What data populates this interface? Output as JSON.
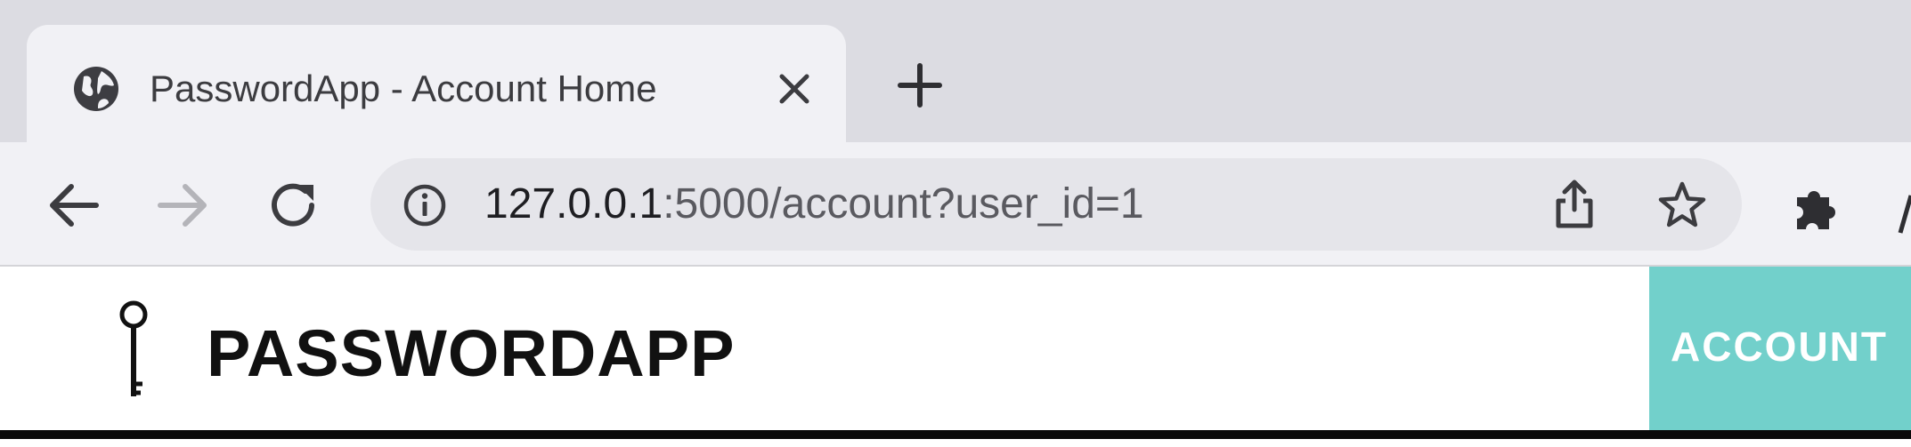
{
  "browser": {
    "tab": {
      "title": "PasswordApp - Account Home",
      "icon": "globe-icon",
      "close_icon": "close-icon"
    },
    "new_tab_icon": "plus-icon",
    "nav": {
      "back_icon": "arrow-left-icon",
      "forward_icon": "arrow-right-icon",
      "reload_icon": "reload-icon"
    },
    "address_bar": {
      "security_icon": "info-icon",
      "url_host": "127.0.0.1",
      "url_rest": ":5000/account?user_id=1",
      "share_icon": "share-icon",
      "bookmark_icon": "star-icon"
    },
    "extensions_icon": "puzzle-icon"
  },
  "app": {
    "logo_icon": "key-icon",
    "brand": "PASSWORDAPP",
    "nav": {
      "account_label": "ACCOUNT",
      "account_color": "#72d0cb"
    },
    "rule_color": "#0a0a0a"
  }
}
